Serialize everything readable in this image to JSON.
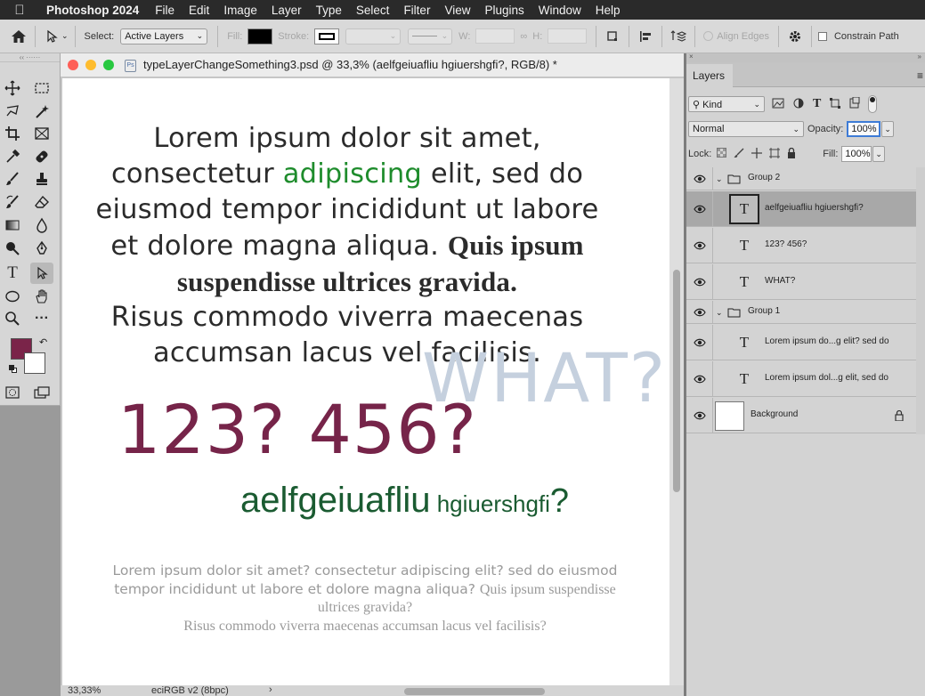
{
  "menubar": {
    "app_name": "Photoshop 2024",
    "items": [
      "File",
      "Edit",
      "Image",
      "Layer",
      "Type",
      "Select",
      "Filter",
      "View",
      "Plugins",
      "Window",
      "Help"
    ]
  },
  "options_bar": {
    "select_label": "Select:",
    "select_value": "Active Layers",
    "fill_label": "Fill:",
    "stroke_label": "Stroke:",
    "w_label": "W:",
    "h_label": "H:",
    "align_edges_label": "Align Edges",
    "constrain_label": "Constrain Path",
    "fill_color": "#000000"
  },
  "toolbox": {
    "foreground_color": "#7a2449",
    "background_color": "#ffffff"
  },
  "document": {
    "title": "typeLayerChangeSomething3.psd @ 33,3% (aelfgeiuafliu hgiuershgfi?, RGB/8) *",
    "zoom": "33,33%",
    "profile": "eciRGB v2 (8bpc)"
  },
  "canvas": {
    "lorem1": {
      "l1": "Lorem ipsum dolor sit amet,",
      "l2a": "consectetur ",
      "l2b": "adipiscing",
      "l2c": " elit, sed do",
      "l3": "eiusmod tempor incididunt ut labore",
      "l4a": "et dolore magna aliqua. ",
      "l4b": "Quis ipsum",
      "l5": "suspendisse ultrices gravida.",
      "l6": "Risus commodo viverra maecenas",
      "l7": "accumsan lacus vel facilisis."
    },
    "what": "WHAT?",
    "numbers": "123? 456?",
    "aelf_big": "aelfgeiuafliu",
    "aelf_small": " hgiuershgfi",
    "aelf_q": "?",
    "lorem2": {
      "l1": "Lorem ipsum dolor sit amet? consectetur adipiscing elit? sed do eiusmod",
      "l2a": "tempor incididunt ut labore et dolore magna aliqua? ",
      "l2b": "Quis ipsum suspendisse",
      "l3": "ultrices gravida?",
      "l4": "Risus commodo viverra maecenas accumsan lacus vel facilisis?"
    }
  },
  "layers_panel": {
    "tab": "Layers",
    "kind_label": "Kind",
    "blend_mode": "Normal",
    "opacity_label": "Opacity:",
    "opacity_value": "100%",
    "lock_label": "Lock:",
    "fill_label": "Fill:",
    "fill_value": "100%",
    "layers": [
      {
        "type": "group",
        "name": "Group 2"
      },
      {
        "type": "text",
        "name": "aelfgeiuafliu hgiuershgfi?",
        "selected": true
      },
      {
        "type": "text",
        "name": "123? 456?"
      },
      {
        "type": "text",
        "name": "WHAT?"
      },
      {
        "type": "group",
        "name": "Group 1"
      },
      {
        "type": "text",
        "name": "Lorem ipsum do...g elit? sed do"
      },
      {
        "type": "text",
        "name": "Lorem ipsum dol...g elit, sed do"
      },
      {
        "type": "background",
        "name": "Background"
      }
    ]
  }
}
